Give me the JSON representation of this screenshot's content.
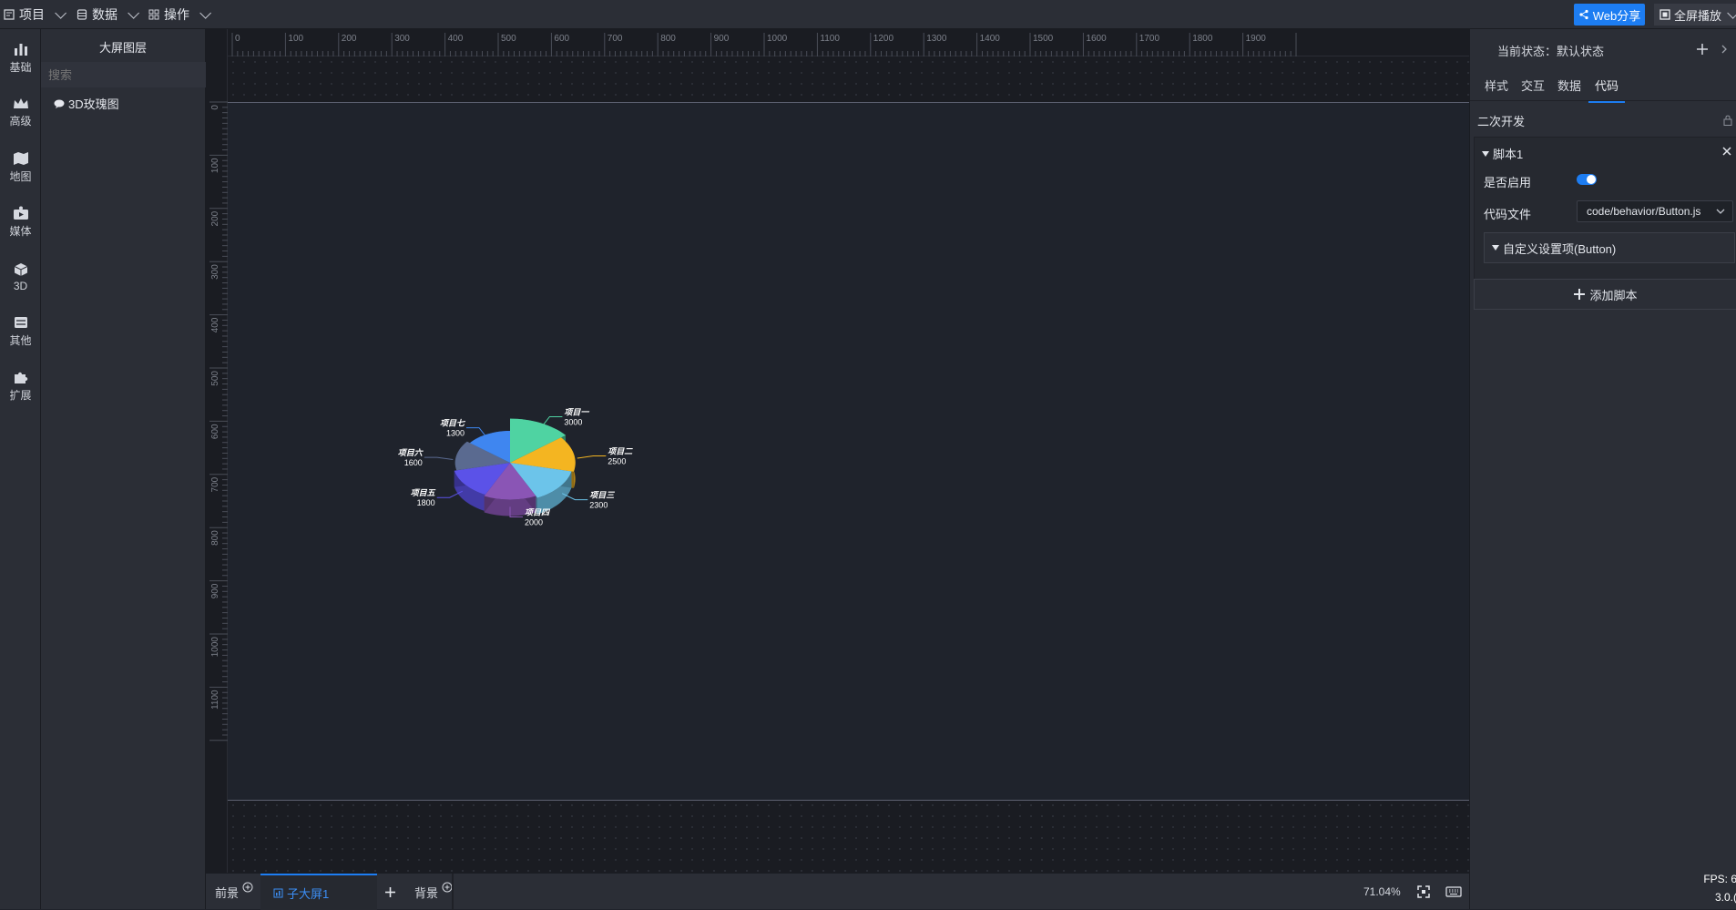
{
  "topbar": {
    "menus": [
      {
        "label": "项目",
        "icon": "project-icon"
      },
      {
        "label": "数据",
        "icon": "database-icon"
      },
      {
        "label": "操作",
        "icon": "grid-icon"
      }
    ],
    "web_share": "Web分享",
    "fullscreen": "全屏播放"
  },
  "rail": {
    "items": [
      {
        "label": "基础",
        "icon": "bar-chart-icon"
      },
      {
        "label": "高级",
        "icon": "crown-icon"
      },
      {
        "label": "地图",
        "icon": "map-icon"
      },
      {
        "label": "媒体",
        "icon": "media-icon"
      },
      {
        "label": "3D",
        "icon": "cube-icon"
      },
      {
        "label": "其他",
        "icon": "stack-icon"
      },
      {
        "label": "扩展",
        "icon": "puzzle-icon"
      }
    ]
  },
  "layers": {
    "tab": "大屏图层",
    "search_placeholder": "搜索",
    "items": [
      {
        "label": "3D玫瑰图",
        "icon": "chart-bubble-icon"
      }
    ]
  },
  "ruler": {
    "top_ticks": [
      "0",
      "100",
      "200",
      "300",
      "400",
      "500",
      "600",
      "700",
      "800",
      "900",
      "1000",
      "1100",
      "1200",
      "1300",
      "1400",
      "1500",
      "1600",
      "1700",
      "1800",
      "1900"
    ],
    "left_ticks": [
      "0",
      "100",
      "200",
      "300",
      "400",
      "500",
      "600",
      "700",
      "800",
      "900",
      "1000",
      "1100"
    ]
  },
  "chart_data": {
    "type": "pie",
    "categories": [
      "项目一",
      "项目二",
      "项目三",
      "项目四",
      "项目五",
      "项目六",
      "项目七"
    ],
    "values": [
      3000,
      2500,
      2300,
      2000,
      1800,
      1600,
      1300
    ],
    "colors": [
      "#4fd3a2",
      "#f4b521",
      "#6cc4ea",
      "#8a55b5",
      "#5b52e8",
      "#5a6a90",
      "#3f86f0"
    ],
    "rose": true,
    "three_d": true
  },
  "bottombar": {
    "foreground": "前景",
    "active_tab": "子大屏1",
    "background": "背景",
    "zoom": "71.04%",
    "fps": "FPS: 6",
    "version": "3.0.("
  },
  "right": {
    "state_label": "当前状态：默认状态",
    "tabs": [
      "样式",
      "交互",
      "数据",
      "代码"
    ],
    "active_tab_index": 3,
    "section": "二次开发",
    "script": {
      "title": "脚本1",
      "enabled_label": "是否启用",
      "enabled": true,
      "code_file_label": "代码文件",
      "code_file": "code/behavior/Button.js",
      "custom_settings": "自定义设置项(Button)"
    },
    "add_script": "添加脚本"
  },
  "colors": {
    "accent": "#1d7df2",
    "bg": "#1f222a",
    "panel": "#2b2e36"
  }
}
